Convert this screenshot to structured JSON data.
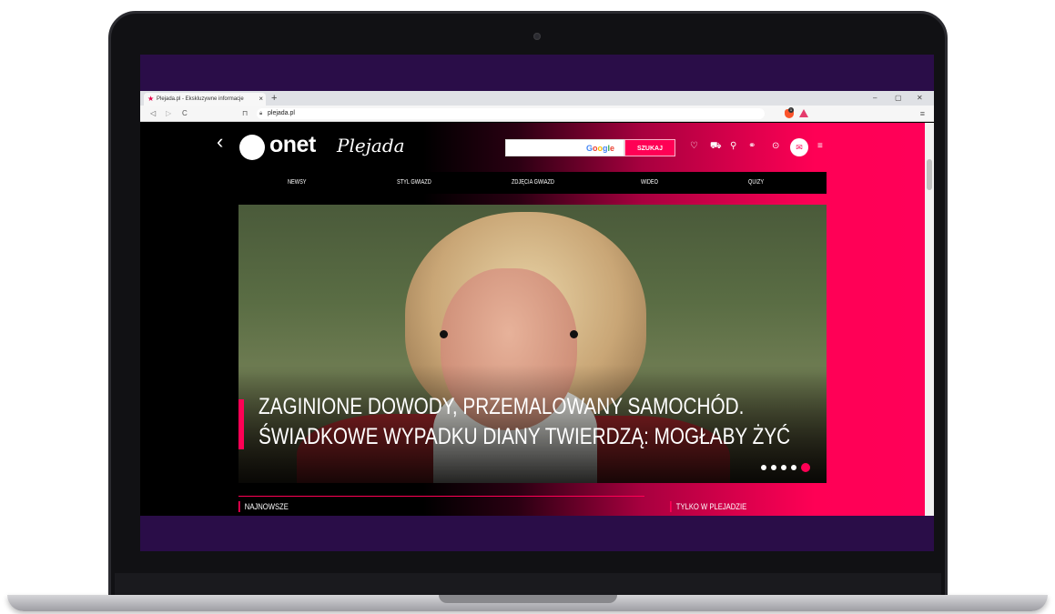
{
  "browser": {
    "tab_title": "Plejada.pl - Ekskluzywne informacje",
    "tab_close": "×",
    "new_tab": "+",
    "nav": {
      "back": "◁",
      "forward": "▷",
      "reload": "C",
      "bookmark": "⊓"
    },
    "url": "plejada.pl",
    "window": {
      "minimize": "–",
      "maximize": "▢",
      "close": "✕"
    },
    "menu": "≡",
    "extension_badge": "1"
  },
  "site": {
    "back": "‹",
    "brand": "onet",
    "subbrand": "Plejada",
    "search": {
      "powered_by": "Google",
      "button_label": "SZUKAJ"
    },
    "header_icons": [
      "heart-icon",
      "cart-icon",
      "location-pin-icon",
      "motorbike-icon",
      "play-icon",
      "mail-icon",
      "menu-lines-icon"
    ],
    "nav": [
      "NEWSY",
      "STYL GWIAZD",
      "ZDJĘCIA GWIAZD",
      "WIDEO",
      "QUIZY"
    ],
    "hero": {
      "headline_line1": "ZAGINIONE DOWODY, PRZEMALOWANY SAMOCHÓD.",
      "headline_line2": "ŚWIADKOWE WYPADKU DIANY TWIERDZĄ: MOGŁABY ŻYĆ",
      "slides_total": 5,
      "slide_active": 5
    },
    "sections": {
      "latest": "NAJNOWSZE",
      "exclusive": "TYLKO W PLEJADZIE"
    }
  }
}
